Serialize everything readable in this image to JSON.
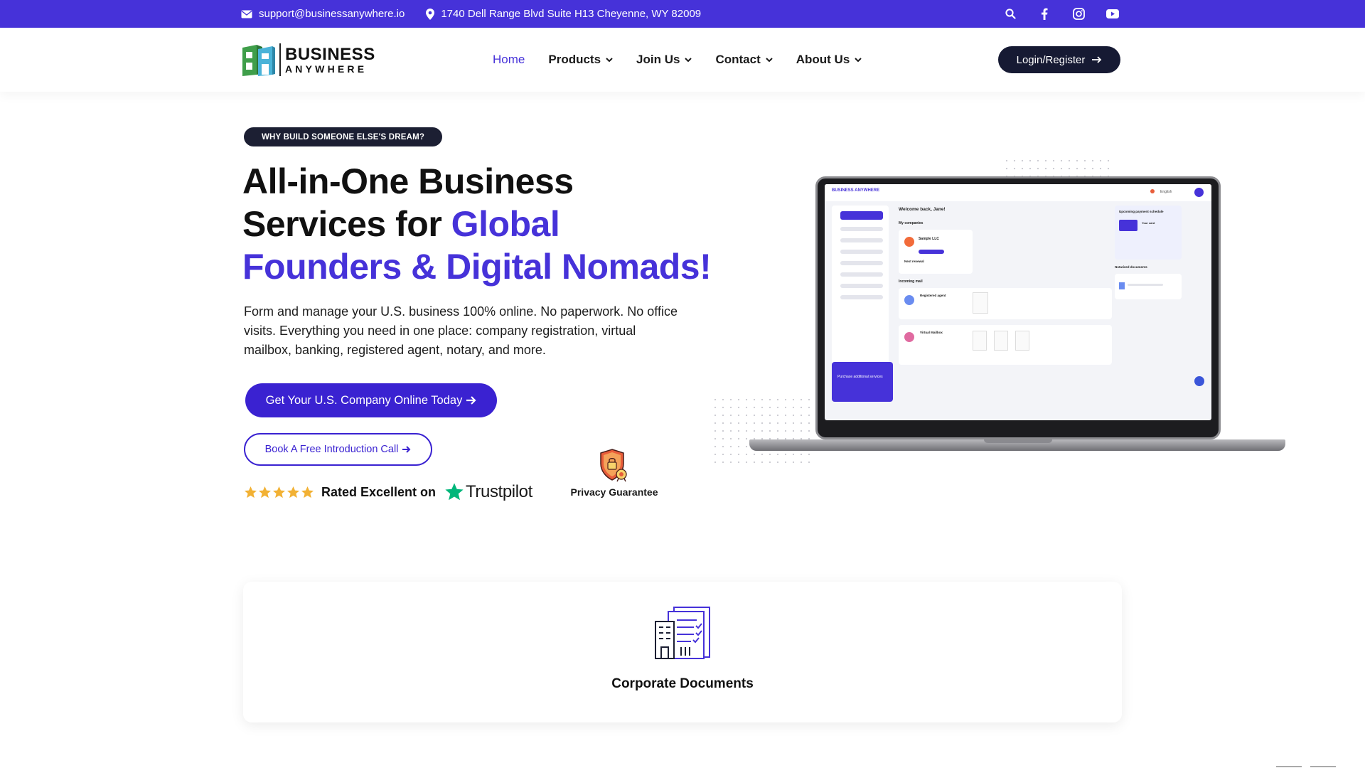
{
  "topbar": {
    "email": "support@businessanywhere.io",
    "address": "1740 Dell Range Blvd Suite H13 Cheyenne, WY 82009",
    "icons": [
      "mail-icon",
      "location-pin-icon",
      "search-icon",
      "facebook-icon",
      "instagram-icon",
      "youtube-icon"
    ]
  },
  "header": {
    "logo_line1": "BUSINESS",
    "logo_line2": "ANYWHERE",
    "nav": [
      {
        "label": "Home",
        "active": true
      },
      {
        "label": "Products",
        "dropdown": true
      },
      {
        "label": "Join Us",
        "dropdown": true
      },
      {
        "label": "Contact",
        "dropdown": true
      },
      {
        "label": "About Us",
        "dropdown": true
      }
    ],
    "login_label": "Login/Register"
  },
  "hero": {
    "pill": "WHY BUILD SOMEONE ELSE'S DREAM?",
    "headline_line1": "All-in-One Business",
    "headline_line2_plain": "Services for ",
    "headline_line2_accent": "Global",
    "headline_line3_accent": "Founders & Digital Nomads!",
    "subtext": "Form and manage your U.S. business 100% online. No paperwork. No office visits. Everything you need in one place: company registration, virtual mailbox, banking, registered agent, notary, and more.",
    "cta_primary": "Get Your U.S. Company Online Today",
    "cta_secondary": "Book A Free Introduction Call",
    "rating_stars": 5,
    "rating_text": "Rated Excellent on",
    "trustpilot": "Trustpilot",
    "privacy_label": "Privacy Guarantee"
  },
  "dashboard": {
    "brand": "BUSINESS ANYWHERE",
    "welcome": "Welcome back, Jane!",
    "my_companies": "My companies",
    "company_name": "Sample LLC",
    "next_renewal": "Next renewal",
    "incoming_mail": "Incoming mail",
    "registered_agent": "Registered agent",
    "virtual_mailbox": "Virtual Mailbox",
    "upcoming_payment": "Upcoming payment schedule",
    "your_card": "Your card",
    "notarized_docs": "Notarized documents",
    "purchase": "Purchase additional services",
    "language": "English"
  },
  "features": [
    {
      "title": "Corporate Documents",
      "icon": "corporate-documents-icon"
    }
  ],
  "colors": {
    "brand": "#4632d9",
    "dark": "#161a33",
    "star": "#f2b134",
    "trustpilot_green": "#00b67a"
  }
}
